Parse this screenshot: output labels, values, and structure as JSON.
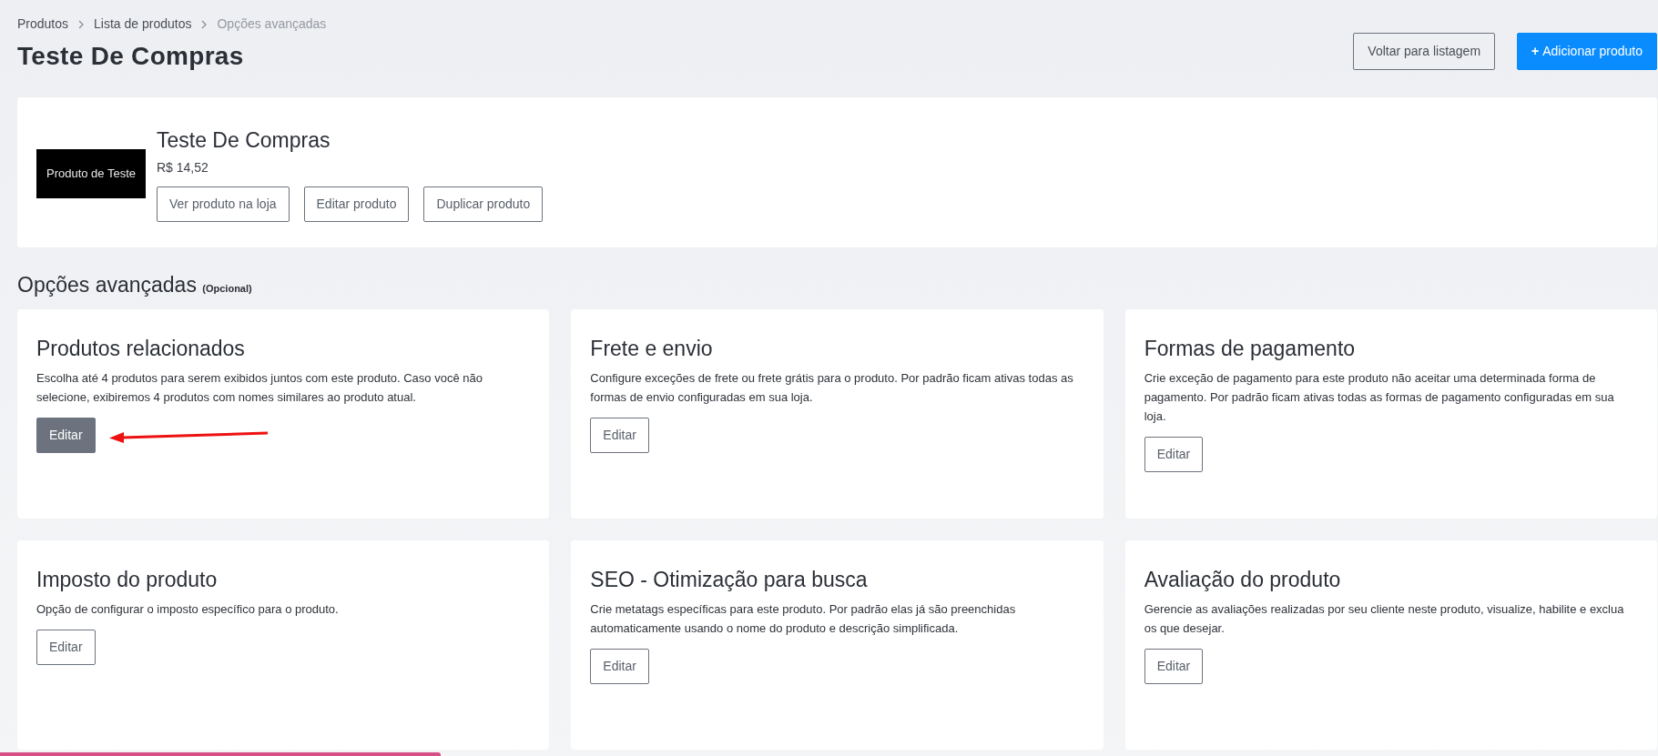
{
  "breadcrumb": [
    {
      "label": "Produtos",
      "current": false
    },
    {
      "label": "Lista de produtos",
      "current": false
    },
    {
      "label": "Opções avançadas",
      "current": true
    }
  ],
  "page_title": "Teste De Compras",
  "header_buttons": [
    {
      "label": "Voltar para listagem",
      "kind": "outline"
    },
    {
      "label": "Adicionar produto",
      "kind": "primary",
      "icon": "+"
    }
  ],
  "product": {
    "image_text": "Produto de Teste",
    "name": "Teste De Compras",
    "price": "R$ 14,52",
    "buttons": [
      "Ver produto na loja",
      "Editar produto",
      "Duplicar produto"
    ]
  },
  "section": {
    "title": "Opções avançadas",
    "note": "(Opcional)"
  },
  "option_cards": [
    {
      "title": "Produtos relacionados",
      "description": "Escolha até 4 produtos para serem exibidos juntos com este produto. Caso você não selecione, exibiremos 4 produtos com nomes similares ao produto atual.",
      "button": "Editar",
      "highlighted": true
    },
    {
      "title": "Frete e envio",
      "description": "Configure exceções de frete ou frete grátis para o produto. Por padrão ficam ativas todas as formas de envio configuradas em sua loja.",
      "button": "Editar",
      "highlighted": false
    },
    {
      "title": "Formas de pagamento",
      "description": "Crie exceção de pagamento para este produto não aceitar uma determinada forma de pagamento. Por padrão ficam ativas todas as formas de pagamento configuradas em sua loja.",
      "button": "Editar",
      "highlighted": false
    },
    {
      "title": "Imposto do produto",
      "description": "Opção de configurar o imposto específico para o produto.",
      "button": "Editar",
      "highlighted": false
    },
    {
      "title": "SEO - Otimização para busca",
      "description": "Crie metatags específicas para este produto. Por padrão elas já são preenchidas automaticamente usando o nome do produto e descrição simplificada.",
      "button": "Editar",
      "highlighted": false
    },
    {
      "title": "Avaliação do produto",
      "description": "Gerencie as avaliações realizadas por seu cliente neste produto, visualize, habilite e exclua os que desejar.",
      "button": "Editar",
      "highlighted": false
    }
  ],
  "loading_bar": {
    "level": 0.266
  }
}
